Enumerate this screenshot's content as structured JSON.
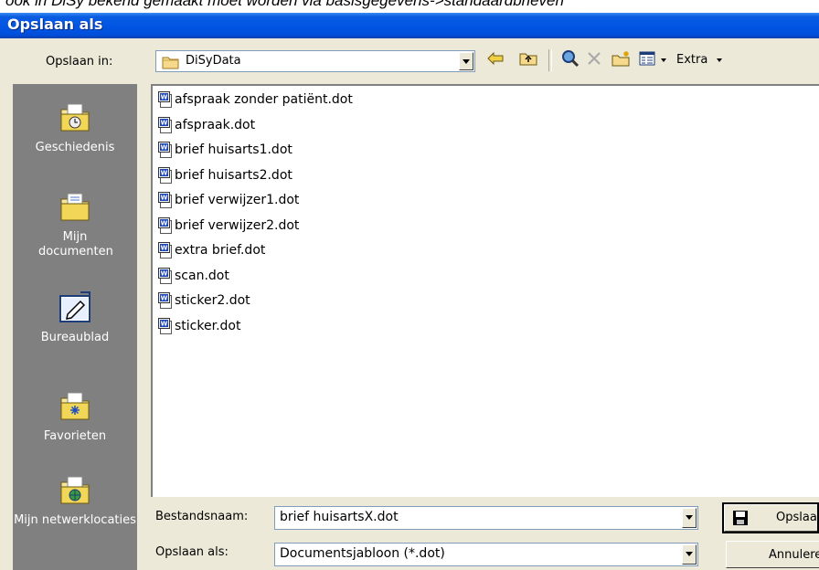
{
  "doc_top_text": "ook in DiSy bekend gemaakt moet worden via basisgegevens->standaardbrieven",
  "window": {
    "title": "Opslaan als"
  },
  "toolbar": {
    "save_in_label": "Opslaan in:",
    "save_in_value": "DiSyData",
    "extra_label": "Extra"
  },
  "places": [
    {
      "label": "Geschiedenis",
      "icon": "history-folder-icon"
    },
    {
      "label": "Mijn documenten",
      "icon": "my-documents-folder-icon"
    },
    {
      "label": "Bureaublad",
      "icon": "desktop-icon"
    },
    {
      "label": "Favorieten",
      "icon": "favorites-folder-icon"
    },
    {
      "label": "Mijn netwerklocaties",
      "icon": "network-places-icon"
    }
  ],
  "files": [
    "afspraak zonder patiënt.dot",
    "afspraak.dot",
    "brief huisarts1.dot",
    "brief huisarts2.dot",
    "brief verwijzer1.dot",
    "brief verwijzer2.dot",
    "extra brief.dot",
    "scan.dot",
    "sticker2.dot",
    "sticker.dot"
  ],
  "form": {
    "filename_label": "Bestandsnaam:",
    "filename_value": "brief huisartsX.dot",
    "filetype_label": "Opslaan als:",
    "filetype_value": "Documentsjabloon (*.dot)"
  },
  "buttons": {
    "save": "Opslaan",
    "cancel": "Annuleren"
  },
  "colors": {
    "titlebar": "#0054e3",
    "places_bg": "#808080",
    "dialog_bg": "#ece9d8"
  }
}
